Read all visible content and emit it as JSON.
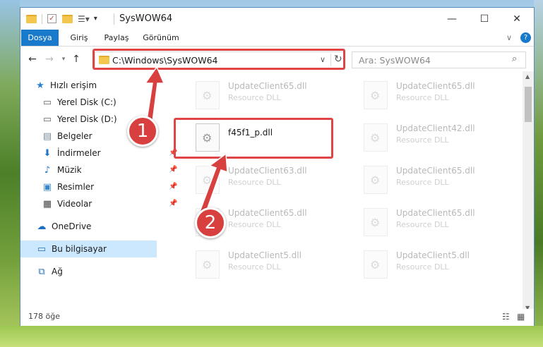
{
  "window": {
    "title": "SysWOW64",
    "controls": {
      "minimize": "—",
      "maximize": "☐",
      "close": "✕"
    }
  },
  "ribbon": {
    "tabs": [
      "Dosya",
      "Giriş",
      "Paylaş",
      "Görünüm"
    ]
  },
  "address": {
    "path": "C:\\Windows\\SysWOW64",
    "search_placeholder": "Ara: SysWOW64"
  },
  "nav": {
    "quick_access": "Hızlı erişim",
    "items": [
      {
        "label": "Yerel Disk (C:)",
        "icon": "drive-icon",
        "pinned": true
      },
      {
        "label": "Yerel Disk (D:)",
        "icon": "drive-icon",
        "pinned": true
      },
      {
        "label": "Belgeler",
        "icon": "documents-icon",
        "pinned": true
      },
      {
        "label": "İndirmeler",
        "icon": "downloads-icon",
        "pinned": true
      },
      {
        "label": "Müzik",
        "icon": "music-icon",
        "pinned": true
      },
      {
        "label": "Resimler",
        "icon": "pictures-icon",
        "pinned": true
      },
      {
        "label": "Videolar",
        "icon": "videos-icon",
        "pinned": true
      }
    ],
    "onedrive": "OneDrive",
    "this_pc": "Bu bilgisayar",
    "network": "Ağ"
  },
  "files": {
    "left": [
      {
        "name": "UpdateClient65.dll",
        "type": "Resource DLL"
      },
      {
        "name": "f45f1_p.dll",
        "type": ""
      },
      {
        "name": "UpdateClient63.dll",
        "type": "Resource DLL"
      },
      {
        "name": "UpdateClient65.dll",
        "type": "Resource DLL"
      },
      {
        "name": "UpdateClient5.dll",
        "type": "Resource DLL"
      }
    ],
    "right": [
      {
        "name": "UpdateClient65.dll",
        "type": "Resource DLL"
      },
      {
        "name": "UpdateClient42.dll",
        "type": "Resource DLL"
      },
      {
        "name": "UpdateClient65.dll",
        "type": "Resource DLL"
      },
      {
        "name": "UpdateClient65.dll",
        "type": "Resource DLL"
      },
      {
        "name": "UpdateClient5.dll",
        "type": "Resource DLL"
      }
    ]
  },
  "status": {
    "item_count": "178 öğe"
  },
  "annotations": {
    "step1": "1",
    "step2": "2",
    "color": "#e04545"
  }
}
